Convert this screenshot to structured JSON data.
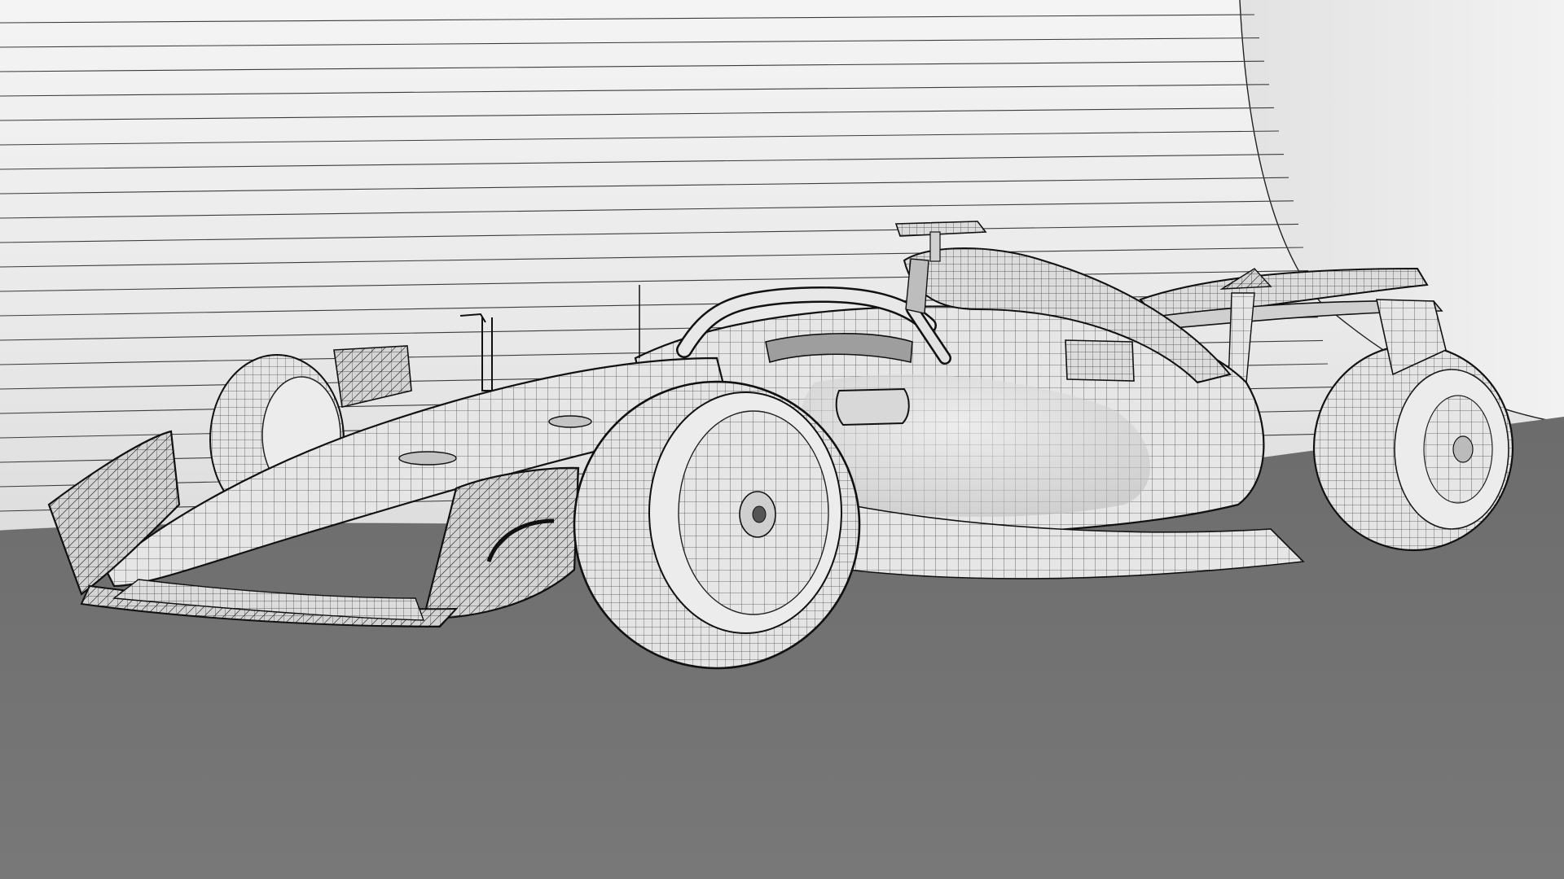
{
  "scene": {
    "subject": "formula-one-car-wireframe",
    "colors": {
      "backdrop": "#efefef",
      "backdrop_shade": "#dadada",
      "floor": "#777777",
      "floor_dark": "#6a6a6a",
      "body_fill": "#e6e6e6",
      "body_shade": "#c9c9c9",
      "mesh_line": "#3a3a3a",
      "outline": "#111111",
      "tire_fill": "#e2e2e2"
    },
    "icons": [
      "backdrop-stripes",
      "studio-cyclorama",
      "wireframe-mesh"
    ]
  }
}
